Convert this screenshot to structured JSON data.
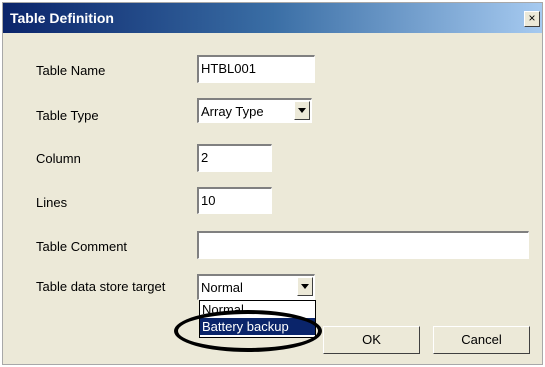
{
  "window": {
    "title": "Table Definition",
    "close_symbol": "×"
  },
  "form": {
    "table_name": {
      "label": "Table Name",
      "value": "HTBL001"
    },
    "table_type": {
      "label": "Table Type",
      "value": "Array Type"
    },
    "column": {
      "label": "Column",
      "value": "2"
    },
    "lines": {
      "label": "Lines",
      "value": "10"
    },
    "table_comment": {
      "label": "Table Comment",
      "value": ""
    },
    "store_target": {
      "label": "Table data store target",
      "value": "Normal",
      "options": [
        "Normal",
        "Battery backup"
      ],
      "highlighted": "Battery backup"
    }
  },
  "buttons": {
    "ok": "OK",
    "cancel": "Cancel"
  },
  "colors": {
    "titlebar": "#0a246a",
    "dialog_bg": "#ece9d8",
    "selection": "#0a246a"
  }
}
